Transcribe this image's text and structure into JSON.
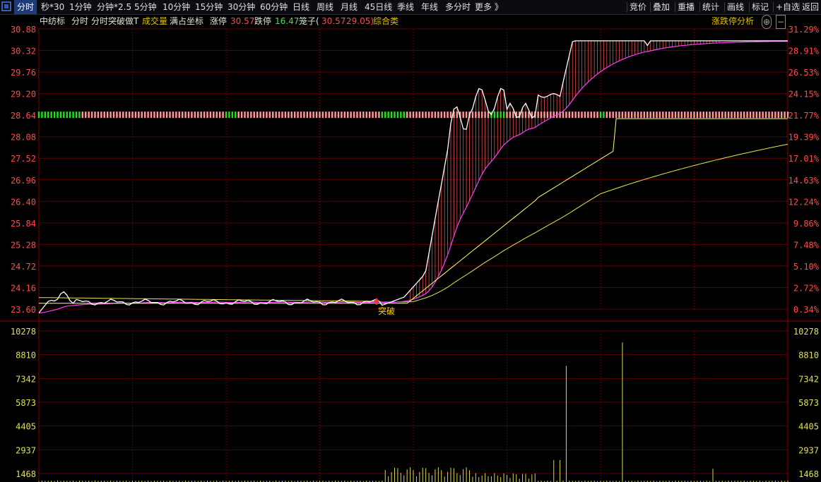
{
  "toolbar": {
    "left_tabs": [
      "分时",
      "秒*30",
      "1分钟",
      "分钟*2.5",
      "5分钟",
      "10分钟",
      "15分钟",
      "30分钟",
      "60分钟",
      "日线",
      "周线",
      "月线",
      "45日线",
      "季线",
      "年线",
      "多分时",
      "更多 》"
    ],
    "active_tab": "分时",
    "right_tabs": [
      "竞价",
      "叠加",
      "重播",
      "统计",
      "画线",
      "标记",
      "+自选",
      "返回"
    ]
  },
  "info_bar": {
    "stock_name": "中纺标",
    "items": [
      "分时",
      "分时突破做T"
    ],
    "volume_label": "成交量",
    "coord_label": "满占坐标",
    "limit_up_label": "涨停",
    "limit_up_value": "30.57",
    "limit_down_label": "跌停",
    "limit_down_value": "16.47",
    "cage_label": "笼子(",
    "cage_high": "30.57",
    "cage_low": "29.05)",
    "composite_label": "综合类",
    "analysis_label": "涨跌停分析"
  },
  "chart_data": {
    "type": "line",
    "price_ticks": [
      "30.88",
      "30.32",
      "29.76",
      "29.20",
      "28.64",
      "28.08",
      "27.52",
      "26.96",
      "26.40",
      "25.84",
      "25.28",
      "24.72",
      "24.16",
      "23.60"
    ],
    "pct_ticks": [
      "31.29%",
      "28.91%",
      "26.53%",
      "24.15%",
      "21.77%",
      "19.39%",
      "17.01%",
      "14.63%",
      "12.24%",
      "9.86%",
      "7.48%",
      "5.10%",
      "2.72%",
      "0.34%"
    ],
    "volume_ticks": [
      "10278",
      "8810",
      "7342",
      "5873",
      "4405",
      "2937",
      "1468"
    ],
    "signal_label": "突破",
    "price_range": [
      23.6,
      30.88
    ],
    "volume_range": [
      0,
      10278
    ],
    "colors": {
      "price": "#ffffff",
      "avg": "#e0e050",
      "ma": "#ff40ff",
      "up": "#ff4040",
      "down": "#00d000",
      "volume": "#d8d850",
      "grid": "#5a0000",
      "axis_red": "#ff4a4a",
      "axis_green": "#40e040"
    }
  }
}
